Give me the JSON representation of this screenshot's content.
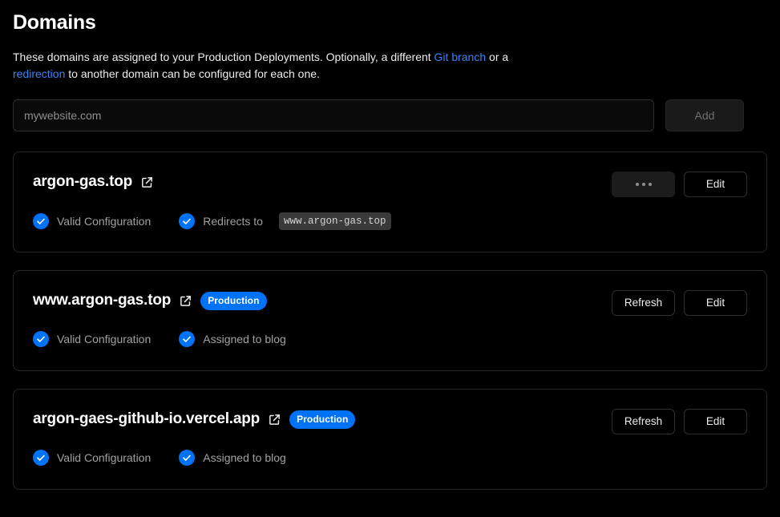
{
  "header": {
    "title": "Domains",
    "description_part1": "These domains are assigned to your Production Deployments. Optionally, a different ",
    "git_branch_link": "Git branch",
    "description_part2": " or a ",
    "redirection_link": "redirection",
    "description_part3": " to another domain can be configured for each one."
  },
  "add_domain": {
    "input_value": "",
    "input_placeholder": "mywebsite.com",
    "add_label": "Add"
  },
  "colors": {
    "accent_blue": "#0072f5",
    "link_blue": "#3b82f6",
    "background": "#000000",
    "card_border": "#262626",
    "muted_text": "#a1a1a1"
  },
  "domains": [
    {
      "name": "argon-gas.top",
      "external_link_icon": "external-link-icon",
      "badge": null,
      "statuses": [
        {
          "icon": "check-circle-icon",
          "label": "Valid Configuration",
          "chip": null
        },
        {
          "icon": "check-circle-icon",
          "label": "Redirects to",
          "chip": "www.argon-gas.top"
        }
      ],
      "actions": [
        {
          "type": "more",
          "label": "…",
          "icon": "ellipsis-icon"
        },
        {
          "type": "edit",
          "label": "Edit",
          "icon": null
        }
      ]
    },
    {
      "name": "www.argon-gas.top",
      "external_link_icon": "external-link-icon",
      "badge": "Production",
      "statuses": [
        {
          "icon": "check-circle-icon",
          "label": "Valid Configuration",
          "chip": null
        },
        {
          "icon": "check-circle-icon",
          "label": "Assigned to blog",
          "chip": null
        }
      ],
      "actions": [
        {
          "type": "refresh",
          "label": "Refresh",
          "icon": null
        },
        {
          "type": "edit",
          "label": "Edit",
          "icon": null
        }
      ]
    },
    {
      "name": "argon-gaes-github-io.vercel.app",
      "external_link_icon": "external-link-icon",
      "badge": "Production",
      "statuses": [
        {
          "icon": "check-circle-icon",
          "label": "Valid Configuration",
          "chip": null
        },
        {
          "icon": "check-circle-icon",
          "label": "Assigned to blog",
          "chip": null
        }
      ],
      "actions": [
        {
          "type": "refresh",
          "label": "Refresh",
          "icon": null
        },
        {
          "type": "edit",
          "label": "Edit",
          "icon": null
        }
      ]
    }
  ]
}
